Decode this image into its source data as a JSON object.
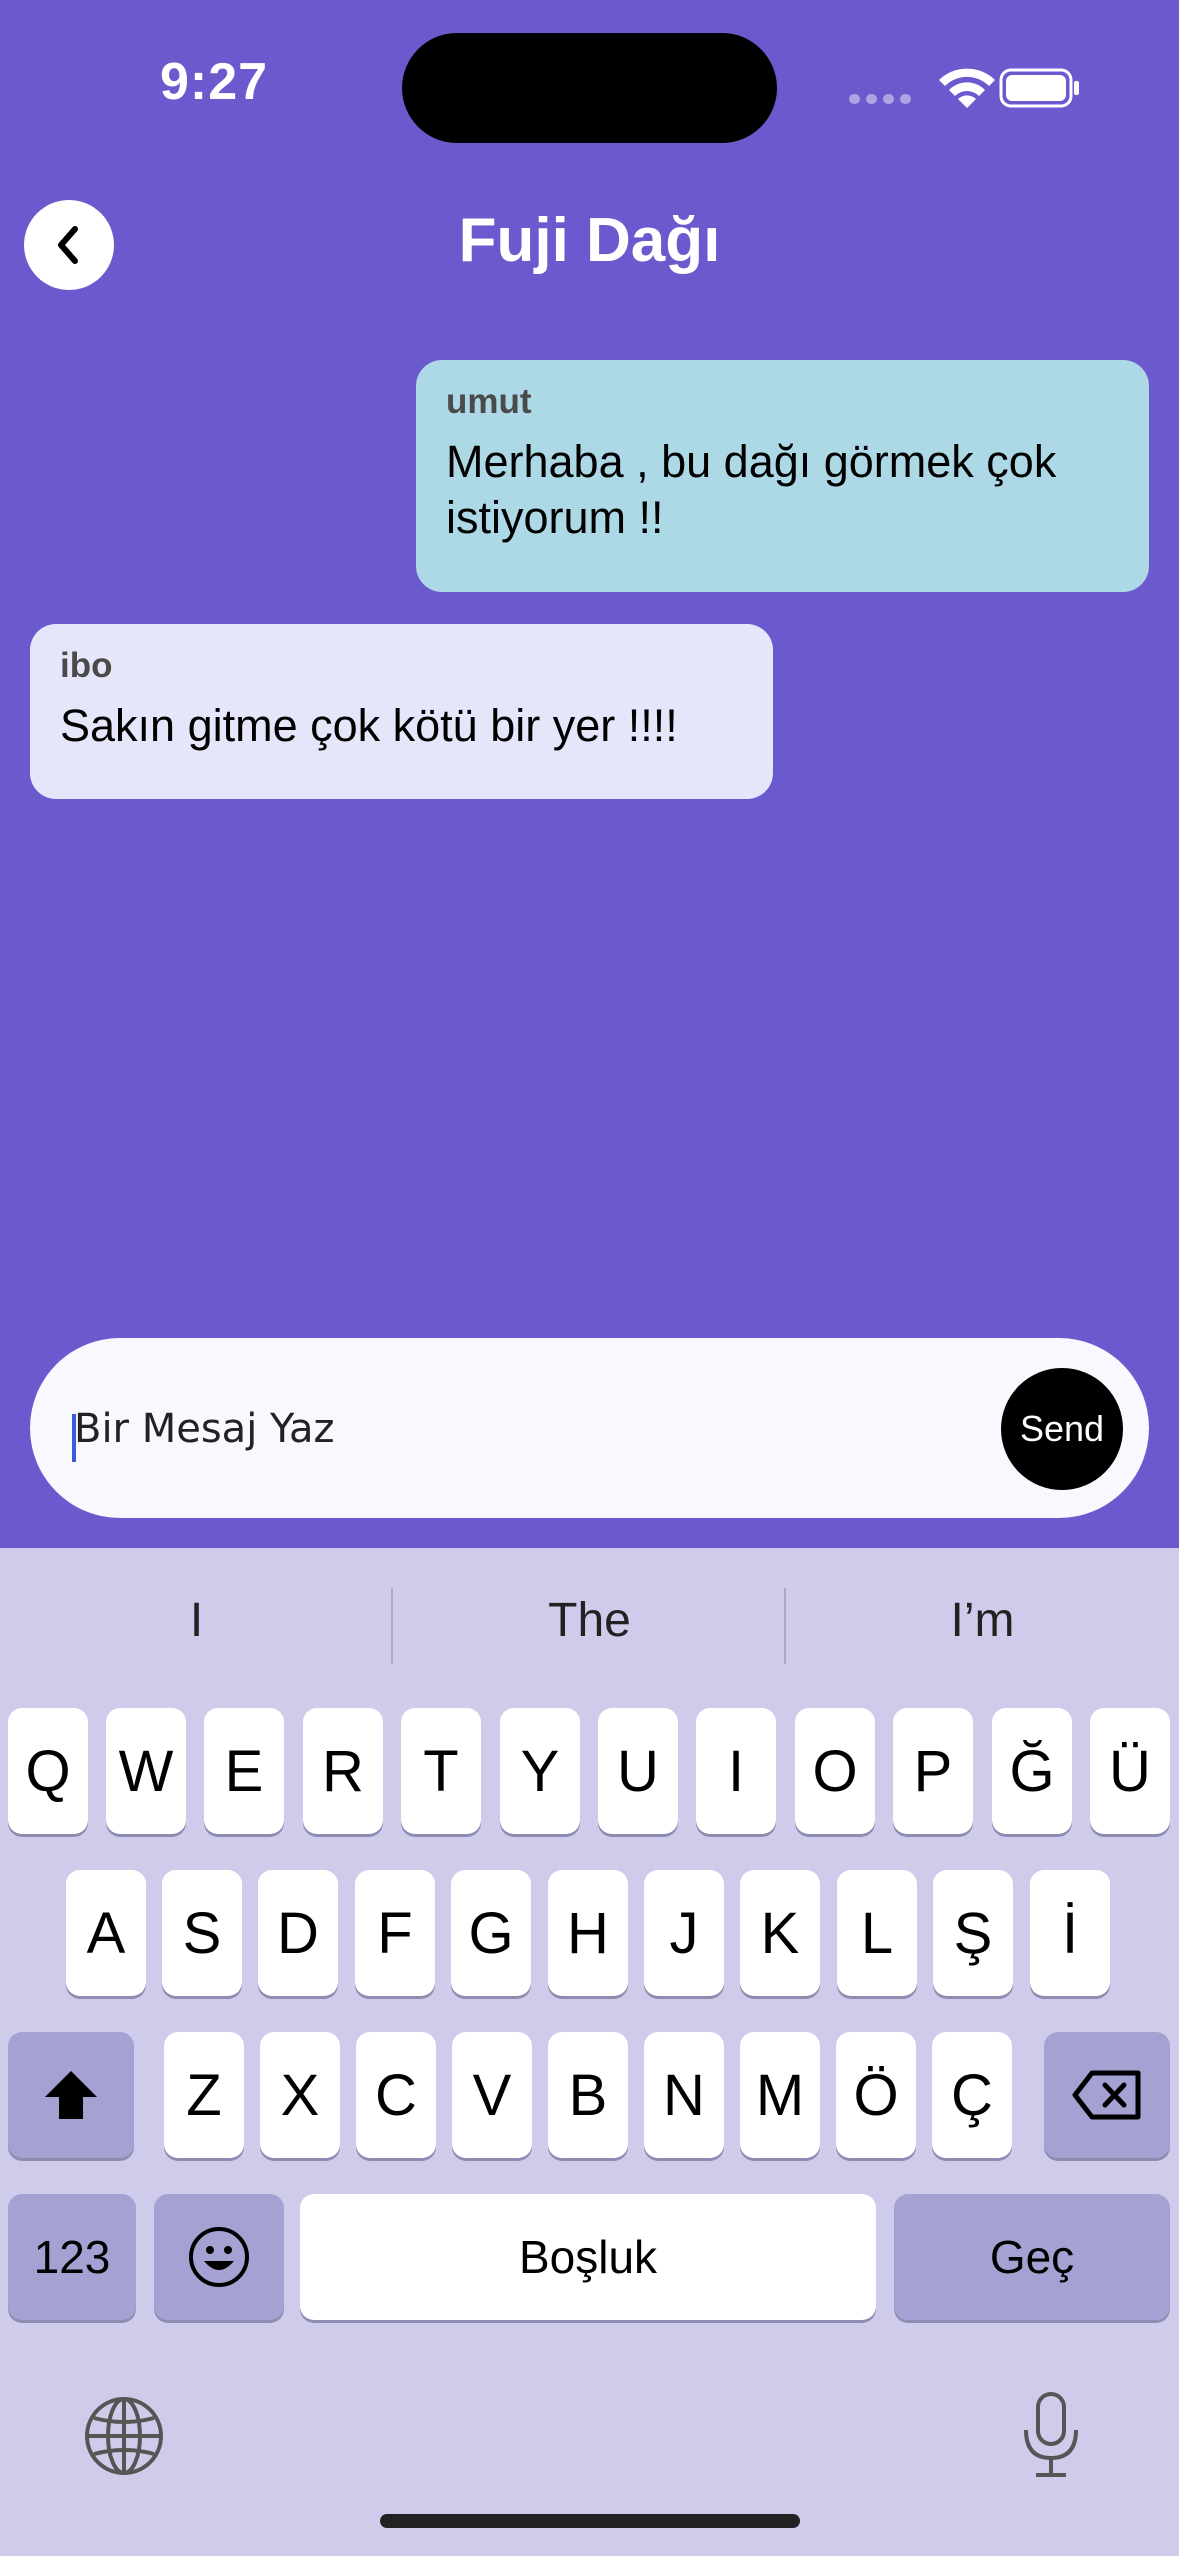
{
  "status_bar": {
    "time": "9:27"
  },
  "header": {
    "title": "Fuji Dağı"
  },
  "messages": [
    {
      "sender": "umut",
      "text": "Merhaba , bu dağı görmek çok istiyorum !!"
    },
    {
      "sender": "ibo",
      "text": "Sakın gitme çok kötü bir yer !!!!"
    }
  ],
  "composer": {
    "placeholder": "Bir Mesaj Yaz",
    "send_label": "Send"
  },
  "keyboard": {
    "suggestions": [
      "I",
      "The",
      "I’m"
    ],
    "row1": [
      "Q",
      "W",
      "E",
      "R",
      "T",
      "Y",
      "U",
      "I",
      "O",
      "P",
      "Ğ",
      "Ü"
    ],
    "row2": [
      "A",
      "S",
      "D",
      "F",
      "G",
      "H",
      "J",
      "K",
      "L",
      "Ş",
      "İ"
    ],
    "row3": [
      "Z",
      "X",
      "C",
      "V",
      "B",
      "N",
      "M",
      "Ö",
      "Ç"
    ],
    "numbers_label": "123",
    "space_label": "Boşluk",
    "return_label": "Geç"
  },
  "colors": {
    "background": "#6a5acd",
    "my_bubble": "#add8e6",
    "their_bubble": "#e6e6fa",
    "keyboard": "#ceccea"
  }
}
